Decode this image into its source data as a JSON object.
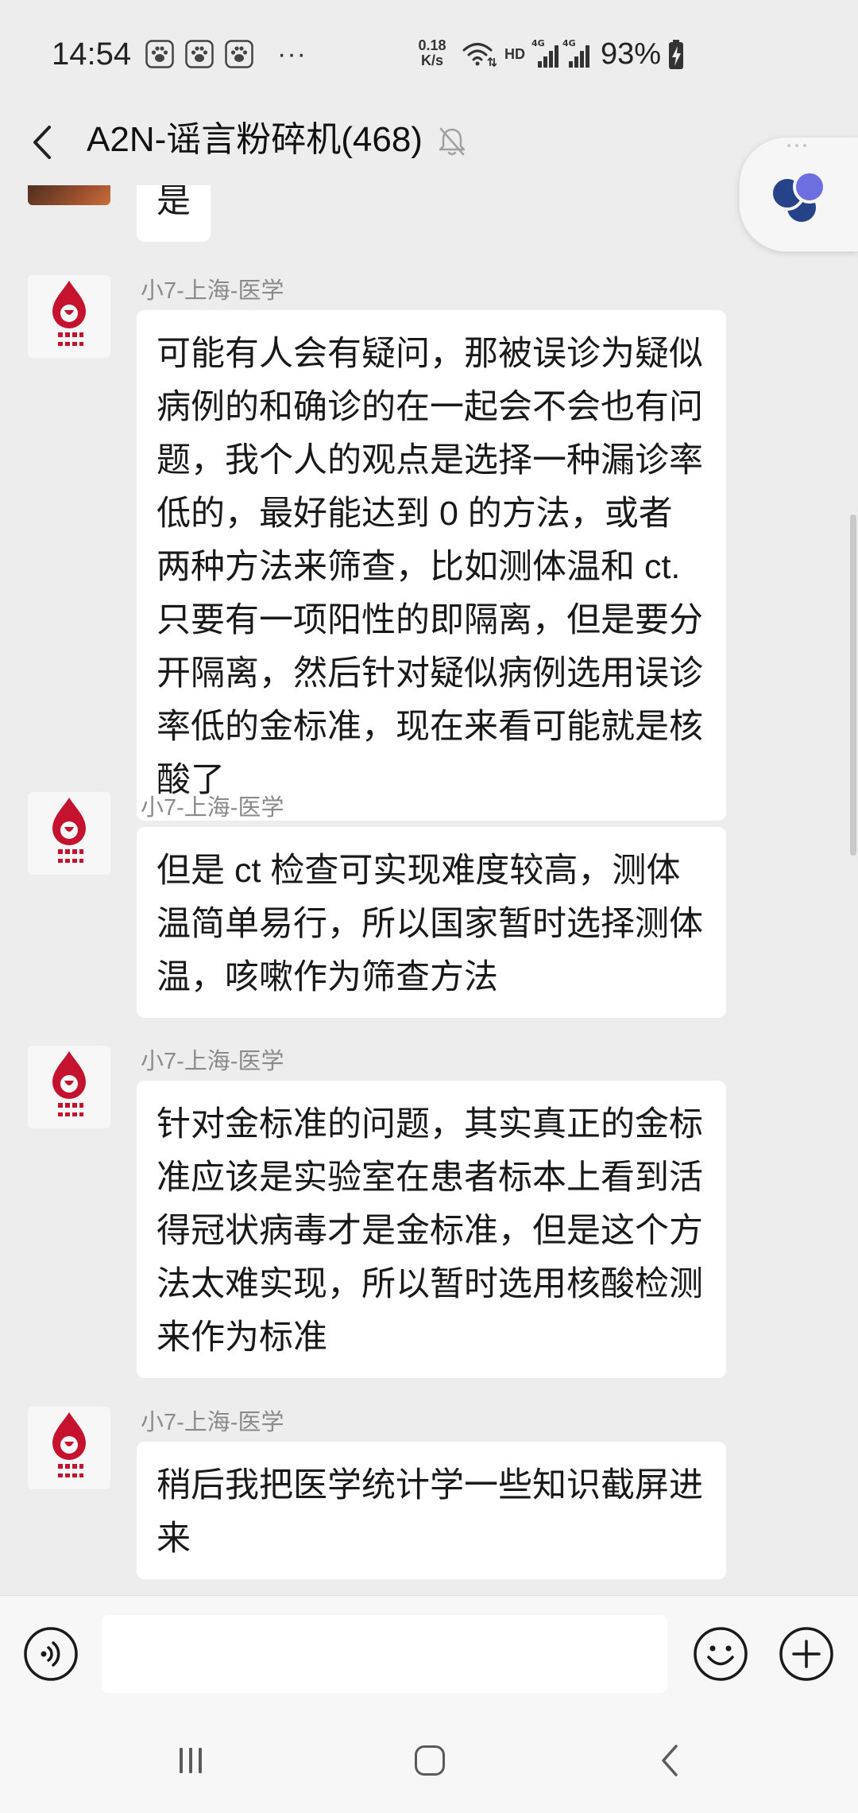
{
  "status_bar": {
    "time": "14:54",
    "notification_icons": [
      "paw-icon",
      "paw-icon",
      "paw-icon"
    ],
    "more": "···",
    "net_speed_value": "0.18",
    "net_speed_unit": "K/s",
    "hd": "HD",
    "sim1_network": "4G",
    "sim2_network": "4G",
    "battery_text": "93%",
    "battery_charging": true,
    "icons": [
      "wifi-icon",
      "signal-icon",
      "battery-charging-icon"
    ]
  },
  "header": {
    "title": "A2N-谣言粉碎机(468)",
    "muted": true,
    "icons": [
      "back-arrow-icon",
      "mute-bell-icon"
    ]
  },
  "floating_widget": {
    "icon": "floating-assistant-logo-icon"
  },
  "messages": [
    {
      "text": "是"
    },
    {
      "sender": "小7-上海-医学",
      "text": "可能有人会有疑问，那被误诊为疑似病例的和确诊的在一起会不会也有问题，我个人的观点是选择一种漏诊率低的，最好能达到 0 的方法，或者两种方法来筛查，比如测体温和 ct.只要有一项阳性的即隔离，但是要分开隔离，然后针对疑似病例选用误诊率低的金标准，现在来看可能就是核酸了"
    },
    {
      "sender": "小7-上海-医学",
      "text": "但是 ct 检查可实现难度较高，测体温简单易行，所以国家暂时选择测体温，咳嗽作为筛查方法"
    },
    {
      "sender": "小7-上海-医学",
      "text": "针对金标准的问题，其实真正的金标准应该是实验室在患者标本上看到活得冠状病毒才是金标准，但是这个方法太难实现，所以暂时选用核酸检测来作为标准"
    },
    {
      "sender": "小7-上海-医学",
      "text": "稍后我把医学统计学一些知识截屏进来"
    }
  ],
  "input_bar": {
    "icons": [
      "voice-icon",
      "emoji-icon",
      "plus-icon"
    ]
  },
  "nav_bar": {
    "icons": [
      "recent-apps-icon",
      "home-icon",
      "back-icon"
    ]
  },
  "colors": {
    "background": "#ededed",
    "bubble": "#ffffff",
    "sender_name": "#8a8a8a",
    "message_text": "#191919",
    "logo_red": "#c4122f",
    "widget_blue": "#26438a",
    "widget_purple": "#6d6ee0"
  }
}
